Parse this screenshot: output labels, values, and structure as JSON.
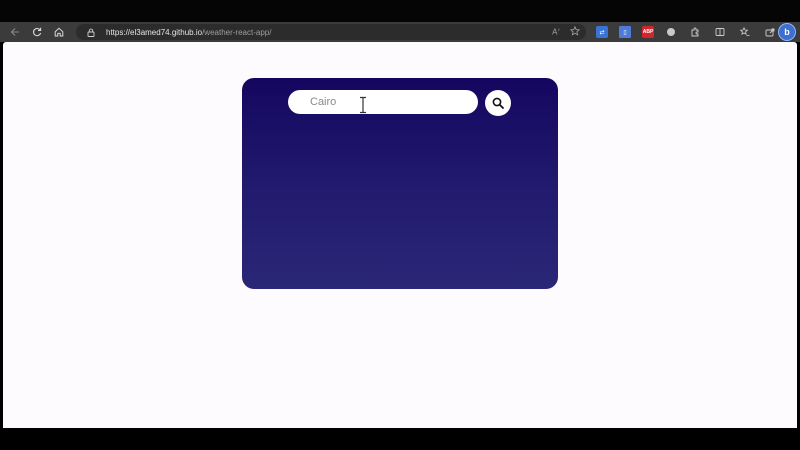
{
  "browser": {
    "url_host": "https://el3amed74.github.io",
    "url_path": "/weather-react-app/",
    "read_aloud_label": "A",
    "extension_abp_label": "ABP",
    "profile_label": "b",
    "icons": [
      "back-icon",
      "refresh-icon",
      "home-icon",
      "lock-icon",
      "read-aloud-icon",
      "favorite-star-icon",
      "translate-extension-icon",
      "page-extension-icon",
      "adblock-extension-icon",
      "circle-extension-icon",
      "extensions-puzzle-icon",
      "split-screen-icon",
      "favorites-icon",
      "share-icon",
      "bing-copilot-icon"
    ]
  },
  "app": {
    "search": {
      "placeholder": "Cairo",
      "value": ""
    },
    "card_gradient": [
      "#14065f",
      "#2b2777"
    ],
    "search_button_icon": "search-icon"
  },
  "colors": {
    "page_background": "#fdfbfe",
    "browser_chrome": "#3b3b3b",
    "card_top": "#14065f",
    "card_bottom": "#2b2777"
  }
}
